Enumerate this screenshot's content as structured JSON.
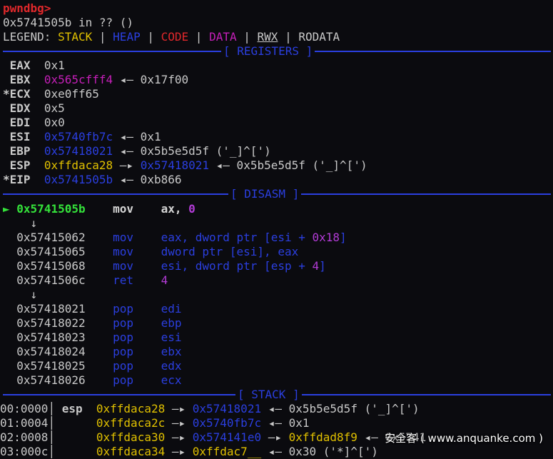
{
  "prompt": "pwndbg>",
  "location": "0x5741505b in ?? ()",
  "legend": {
    "label": "LEGEND:",
    "stack": "STACK",
    "heap": "HEAP",
    "code": "CODE",
    "data": "DATA",
    "rwx": "RWX",
    "rodata": "RODATA",
    "bar": "|"
  },
  "sections": {
    "registers": "[ REGISTERS ]",
    "disasm": "[ DISASM ]",
    "stack": "[ STACK ]"
  },
  "registers": [
    {
      "mark": " ",
      "name": "EAX",
      "value": "0x1",
      "deref": ""
    },
    {
      "mark": " ",
      "name": "EBX",
      "value": "0x565cfff4",
      "deref": "◂— 0x17f00"
    },
    {
      "mark": "*",
      "name": "ECX",
      "value": "0xe0ff65",
      "deref": ""
    },
    {
      "mark": " ",
      "name": "EDX",
      "value": "0x5",
      "deref": ""
    },
    {
      "mark": " ",
      "name": "EDI",
      "value": "0x0",
      "deref": ""
    },
    {
      "mark": " ",
      "name": "ESI",
      "value": "0x5740fb7c",
      "deref": "◂— 0x1"
    },
    {
      "mark": " ",
      "name": "EBP",
      "value": "0x57418021",
      "deref": "◂— 0x5b5e5d5f ('_]^[')"
    },
    {
      "mark": " ",
      "name": "ESP",
      "value": "0xffdaca28",
      "deref_arrow": "—▸",
      "deref_addr": "0x57418021",
      "deref": "◂— 0x5b5e5d5f ('_]^[')"
    },
    {
      "mark": "*",
      "name": "EIP",
      "value": "0x5741505b",
      "deref": "◂— 0xb866"
    }
  ],
  "disasm": {
    "current": {
      "marker": "►",
      "addr": "0x5741505b",
      "mnemonic": "mov",
      "op1": "ax,",
      "op2": "0"
    },
    "down_arrow": "↓",
    "block1": [
      {
        "addr": "0x57415062",
        "mnemonic": "mov",
        "ops": "eax, dword ptr [esi + ",
        "imm": "0x18",
        "tail": "]"
      },
      {
        "addr": "0x57415065",
        "mnemonic": "mov",
        "ops": "dword ptr [esi], eax",
        "imm": "",
        "tail": ""
      },
      {
        "addr": "0x57415068",
        "mnemonic": "mov",
        "ops": "esi, dword ptr [esp + ",
        "imm": "4",
        "tail": "]"
      },
      {
        "addr": "0x5741506c",
        "mnemonic": "ret",
        "ops": "",
        "imm": "4",
        "tail": ""
      }
    ],
    "block2": [
      {
        "addr": "0x57418021",
        "mnemonic": "pop",
        "ops": "edi"
      },
      {
        "addr": "0x57418022",
        "mnemonic": "pop",
        "ops": "ebp"
      },
      {
        "addr": "0x57418023",
        "mnemonic": "pop",
        "ops": "esi"
      },
      {
        "addr": "0x57418024",
        "mnemonic": "pop",
        "ops": "ebx"
      },
      {
        "addr": "0x57418025",
        "mnemonic": "pop",
        "ops": "edx"
      },
      {
        "addr": "0x57418026",
        "mnemonic": "pop",
        "ops": "ecx"
      }
    ]
  },
  "stack": [
    {
      "idx": "00:0000",
      "reg": "esp",
      "addr": "0xffdaca28",
      "p1": "0x57418021",
      "p1c": "blue",
      "p2": "",
      "tail": "◂— 0x5b5e5d5f ('_]^[')"
    },
    {
      "idx": "01:0004",
      "reg": "",
      "addr": "0xffdaca2c",
      "p1": "0x5740fb7c",
      "p1c": "blue",
      "p2": "",
      "tail": "◂— 0x1"
    },
    {
      "idx": "02:0008",
      "reg": "",
      "addr": "0xffdaca30",
      "p1": "0x574141e0",
      "p1c": "blue",
      "p2": "0xffdad8f9",
      "tail": "◂— 0x5741"
    },
    {
      "idx": "03:000c",
      "reg": "",
      "addr": "0xffdaca34",
      "p1": "0xffdac7__",
      "p1c": "yellow",
      "p2": "",
      "tail": "◂— 0x30 ('*]^[')"
    }
  ],
  "watermark": "安全客 ( www.anquanke.com )"
}
